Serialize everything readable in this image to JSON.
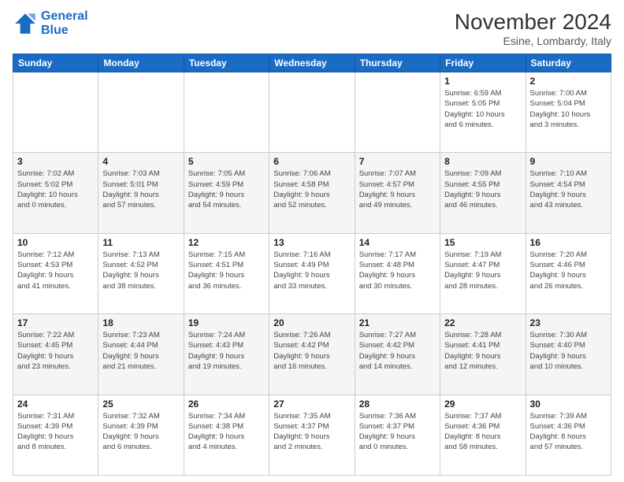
{
  "header": {
    "logo_line1": "General",
    "logo_line2": "Blue",
    "month_title": "November 2024",
    "location": "Esine, Lombardy, Italy"
  },
  "weekdays": [
    "Sunday",
    "Monday",
    "Tuesday",
    "Wednesday",
    "Thursday",
    "Friday",
    "Saturday"
  ],
  "weeks": [
    [
      {
        "day": "",
        "info": ""
      },
      {
        "day": "",
        "info": ""
      },
      {
        "day": "",
        "info": ""
      },
      {
        "day": "",
        "info": ""
      },
      {
        "day": "",
        "info": ""
      },
      {
        "day": "1",
        "info": "Sunrise: 6:59 AM\nSunset: 5:05 PM\nDaylight: 10 hours\nand 6 minutes."
      },
      {
        "day": "2",
        "info": "Sunrise: 7:00 AM\nSunset: 5:04 PM\nDaylight: 10 hours\nand 3 minutes."
      }
    ],
    [
      {
        "day": "3",
        "info": "Sunrise: 7:02 AM\nSunset: 5:02 PM\nDaylight: 10 hours\nand 0 minutes."
      },
      {
        "day": "4",
        "info": "Sunrise: 7:03 AM\nSunset: 5:01 PM\nDaylight: 9 hours\nand 57 minutes."
      },
      {
        "day": "5",
        "info": "Sunrise: 7:05 AM\nSunset: 4:59 PM\nDaylight: 9 hours\nand 54 minutes."
      },
      {
        "day": "6",
        "info": "Sunrise: 7:06 AM\nSunset: 4:58 PM\nDaylight: 9 hours\nand 52 minutes."
      },
      {
        "day": "7",
        "info": "Sunrise: 7:07 AM\nSunset: 4:57 PM\nDaylight: 9 hours\nand 49 minutes."
      },
      {
        "day": "8",
        "info": "Sunrise: 7:09 AM\nSunset: 4:55 PM\nDaylight: 9 hours\nand 46 minutes."
      },
      {
        "day": "9",
        "info": "Sunrise: 7:10 AM\nSunset: 4:54 PM\nDaylight: 9 hours\nand 43 minutes."
      }
    ],
    [
      {
        "day": "10",
        "info": "Sunrise: 7:12 AM\nSunset: 4:53 PM\nDaylight: 9 hours\nand 41 minutes."
      },
      {
        "day": "11",
        "info": "Sunrise: 7:13 AM\nSunset: 4:52 PM\nDaylight: 9 hours\nand 38 minutes."
      },
      {
        "day": "12",
        "info": "Sunrise: 7:15 AM\nSunset: 4:51 PM\nDaylight: 9 hours\nand 36 minutes."
      },
      {
        "day": "13",
        "info": "Sunrise: 7:16 AM\nSunset: 4:49 PM\nDaylight: 9 hours\nand 33 minutes."
      },
      {
        "day": "14",
        "info": "Sunrise: 7:17 AM\nSunset: 4:48 PM\nDaylight: 9 hours\nand 30 minutes."
      },
      {
        "day": "15",
        "info": "Sunrise: 7:19 AM\nSunset: 4:47 PM\nDaylight: 9 hours\nand 28 minutes."
      },
      {
        "day": "16",
        "info": "Sunrise: 7:20 AM\nSunset: 4:46 PM\nDaylight: 9 hours\nand 26 minutes."
      }
    ],
    [
      {
        "day": "17",
        "info": "Sunrise: 7:22 AM\nSunset: 4:45 PM\nDaylight: 9 hours\nand 23 minutes."
      },
      {
        "day": "18",
        "info": "Sunrise: 7:23 AM\nSunset: 4:44 PM\nDaylight: 9 hours\nand 21 minutes."
      },
      {
        "day": "19",
        "info": "Sunrise: 7:24 AM\nSunset: 4:43 PM\nDaylight: 9 hours\nand 19 minutes."
      },
      {
        "day": "20",
        "info": "Sunrise: 7:26 AM\nSunset: 4:42 PM\nDaylight: 9 hours\nand 16 minutes."
      },
      {
        "day": "21",
        "info": "Sunrise: 7:27 AM\nSunset: 4:42 PM\nDaylight: 9 hours\nand 14 minutes."
      },
      {
        "day": "22",
        "info": "Sunrise: 7:28 AM\nSunset: 4:41 PM\nDaylight: 9 hours\nand 12 minutes."
      },
      {
        "day": "23",
        "info": "Sunrise: 7:30 AM\nSunset: 4:40 PM\nDaylight: 9 hours\nand 10 minutes."
      }
    ],
    [
      {
        "day": "24",
        "info": "Sunrise: 7:31 AM\nSunset: 4:39 PM\nDaylight: 9 hours\nand 8 minutes."
      },
      {
        "day": "25",
        "info": "Sunrise: 7:32 AM\nSunset: 4:39 PM\nDaylight: 9 hours\nand 6 minutes."
      },
      {
        "day": "26",
        "info": "Sunrise: 7:34 AM\nSunset: 4:38 PM\nDaylight: 9 hours\nand 4 minutes."
      },
      {
        "day": "27",
        "info": "Sunrise: 7:35 AM\nSunset: 4:37 PM\nDaylight: 9 hours\nand 2 minutes."
      },
      {
        "day": "28",
        "info": "Sunrise: 7:36 AM\nSunset: 4:37 PM\nDaylight: 9 hours\nand 0 minutes."
      },
      {
        "day": "29",
        "info": "Sunrise: 7:37 AM\nSunset: 4:36 PM\nDaylight: 8 hours\nand 58 minutes."
      },
      {
        "day": "30",
        "info": "Sunrise: 7:39 AM\nSunset: 4:36 PM\nDaylight: 8 hours\nand 57 minutes."
      }
    ]
  ]
}
